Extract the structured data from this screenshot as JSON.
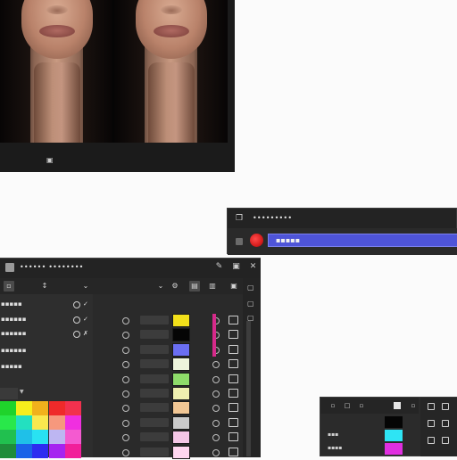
{
  "preview": {
    "status_icon": "▣"
  },
  "color_popup": {
    "title_icon": "❐",
    "title": "•••••••••",
    "field_value": "▪▪▪▪▪"
  },
  "main_panel": {
    "title": "•••••• ••••••••",
    "toolbar_icons": [
      "▫",
      "↕",
      "⌄",
      "⌄",
      "⚙",
      "▤",
      "▥"
    ],
    "layers": [
      {
        "name": "▪▪▪▪▪"
      },
      {
        "name": "▪▪▪▪▪▪"
      },
      {
        "name": "▪▪▪▪▪▪"
      },
      {
        "name": "▪▪▪▪▪▪"
      },
      {
        "name": "▪▪▪▪▪"
      }
    ],
    "channel_swatches": [
      "#f2e01a",
      "#050505",
      "#6a6ef2",
      "#eef5dc",
      "#8edc6a",
      "#eef0b0",
      "#f1c694",
      "#c9c9c9",
      "#f4c6e6",
      "#ffd6f0"
    ]
  },
  "swatch_grid": {
    "colors": [
      [
        "#1fd32b",
        "#f6ee1c",
        "#f1b11c",
        "#ef2a2a",
        "#f2314e"
      ],
      [
        "#29e84a",
        "#23e0c0",
        "#f9e84e",
        "#f6987d",
        "#f02fe0"
      ],
      [
        "#21c04f",
        "#1fc0e8",
        "#29e2f2",
        "#bdb6f2",
        "#f45ad0"
      ],
      [
        "#1f8c3a",
        "#1a62e8",
        "#2d2df0",
        "#a624f0",
        "#f11f9a"
      ]
    ]
  },
  "mini_panel": {
    "tool_icons": [
      "▫",
      "□",
      "▫",
      "■",
      "▫"
    ],
    "rows": [
      {
        "label": "",
        "color": "#050505"
      },
      {
        "label": "▪▪▪",
        "color": "#2ee4f4"
      },
      {
        "label": "▪▪▪▪",
        "color": "#e02fe0"
      }
    ]
  },
  "colors": {
    "accent_blue": "#4e54d8",
    "record_red": "#d61d1d",
    "highlight_pink": "#d52a8a"
  }
}
